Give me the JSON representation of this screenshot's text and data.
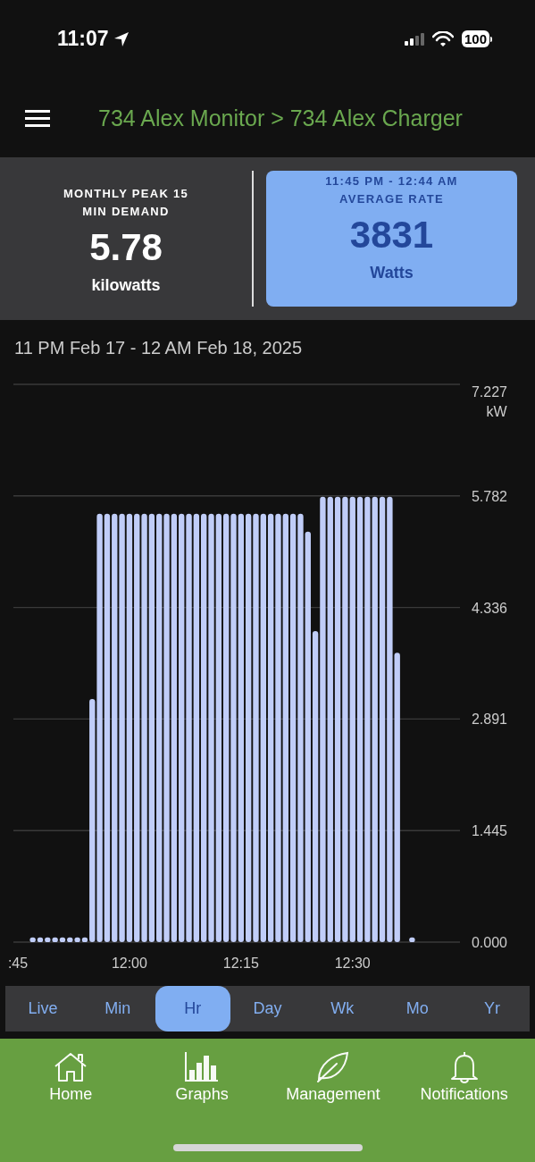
{
  "status_bar": {
    "time": "11:07",
    "battery": "100"
  },
  "header": {
    "title": "734 Alex Monitor > 734 Alex Charger"
  },
  "cards": [
    {
      "label": "MONTHLY PEAK 15 MIN DEMAND",
      "value": "5.78",
      "unit": "kilowatts",
      "selected": false
    },
    {
      "subtitle": "11:45 PM - 12:44 AM",
      "label": "AVERAGE RATE",
      "value": "3831",
      "unit": "Watts",
      "selected": true
    }
  ],
  "date_range": "11 PM Feb 17 - 12 AM Feb 18, 2025",
  "chart_data": {
    "type": "bar",
    "ylabel": "kW",
    "categories": [
      ":45",
      null,
      null,
      null,
      null,
      null,
      null,
      null,
      null,
      null,
      null,
      null,
      null,
      null,
      null,
      "12:00",
      null,
      null,
      null,
      null,
      null,
      null,
      null,
      null,
      null,
      null,
      null,
      null,
      null,
      null,
      "12:15",
      null,
      null,
      null,
      null,
      null,
      null,
      null,
      null,
      null,
      null,
      null,
      null,
      null,
      null,
      "12:30",
      null,
      null,
      null,
      null,
      null,
      null,
      null,
      null,
      null,
      null,
      null,
      null
    ],
    "series": [
      {
        "color": "#c0cdf8",
        "values": [
          null,
          null,
          0.06,
          0.06,
          0.06,
          0.06,
          0.06,
          0.06,
          0.06,
          0.06,
          3.15,
          5.55,
          5.55,
          5.55,
          5.55,
          5.55,
          5.55,
          5.55,
          5.55,
          5.55,
          5.55,
          5.55,
          5.55,
          5.55,
          5.55,
          5.55,
          5.55,
          5.55,
          5.55,
          5.55,
          5.55,
          5.55,
          5.55,
          5.55,
          5.55,
          5.55,
          5.55,
          5.55,
          5.55,
          5.32,
          4.03,
          5.77,
          5.77,
          5.77,
          5.77,
          5.77,
          5.77,
          5.77,
          5.77,
          5.77,
          5.77,
          3.75,
          null,
          0.06,
          null,
          null,
          null,
          null
        ]
      }
    ],
    "grid": true,
    "ylim": [
      0,
      7.227
    ],
    "yticks": [
      {
        "value": 0,
        "label": "0.000"
      },
      {
        "value": 1.445,
        "label": "1.445"
      },
      {
        "value": 2.891,
        "label": "2.891"
      },
      {
        "value": 4.336,
        "label": "4.336"
      },
      {
        "value": 5.782,
        "label": "5.782"
      },
      {
        "value": 7.227,
        "label": "7.227"
      }
    ]
  },
  "range_tabs": [
    {
      "label": "Live",
      "selected": false
    },
    {
      "label": "Min",
      "selected": false
    },
    {
      "label": "Hr",
      "selected": true
    },
    {
      "label": "Day",
      "selected": false
    },
    {
      "label": "Wk",
      "selected": false
    },
    {
      "label": "Mo",
      "selected": false
    },
    {
      "label": "Yr",
      "selected": false
    }
  ],
  "nav": [
    {
      "label": "Home"
    },
    {
      "label": "Graphs"
    },
    {
      "label": "Management"
    },
    {
      "label": "Notifications"
    }
  ]
}
